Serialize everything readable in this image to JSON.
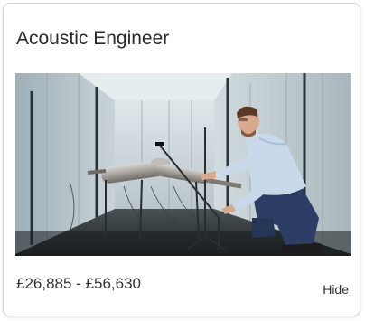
{
  "card": {
    "title": "Acoustic Engineer",
    "salary": "£26,885 - £56,630",
    "hide_label": "Hide"
  }
}
